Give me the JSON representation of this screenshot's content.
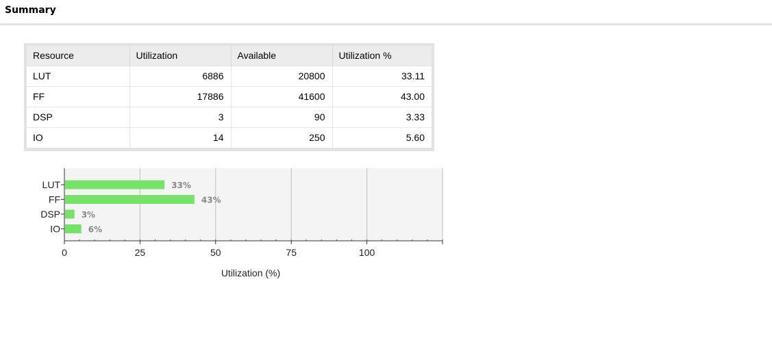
{
  "header": {
    "title": "Summary"
  },
  "table": {
    "columns": [
      "Resource",
      "Utilization",
      "Available",
      "Utilization %"
    ],
    "rows": [
      [
        "LUT",
        "6886",
        "20800",
        "33.11"
      ],
      [
        "FF",
        "17886",
        "41600",
        "43.00"
      ],
      [
        "DSP",
        "3",
        "90",
        "3.33"
      ],
      [
        "IO",
        "14",
        "250",
        "5.60"
      ]
    ]
  },
  "chart_data": {
    "type": "bar",
    "orientation": "horizontal",
    "categories": [
      "LUT",
      "FF",
      "DSP",
      "IO"
    ],
    "values": [
      33.11,
      43.0,
      3.33,
      5.6
    ],
    "data_labels": [
      "33%",
      "43%",
      "3%",
      "6%"
    ],
    "xlabel": "Utilization (%)",
    "ylabel": "",
    "xlim": [
      0,
      125
    ],
    "x_ticks": [
      0,
      25,
      50,
      75,
      100
    ],
    "grid": true,
    "colors": {
      "bar": "#77e26a",
      "plot_bg": "#f4f4f4",
      "grid": "#bdbdbd",
      "label": "#888888"
    }
  }
}
